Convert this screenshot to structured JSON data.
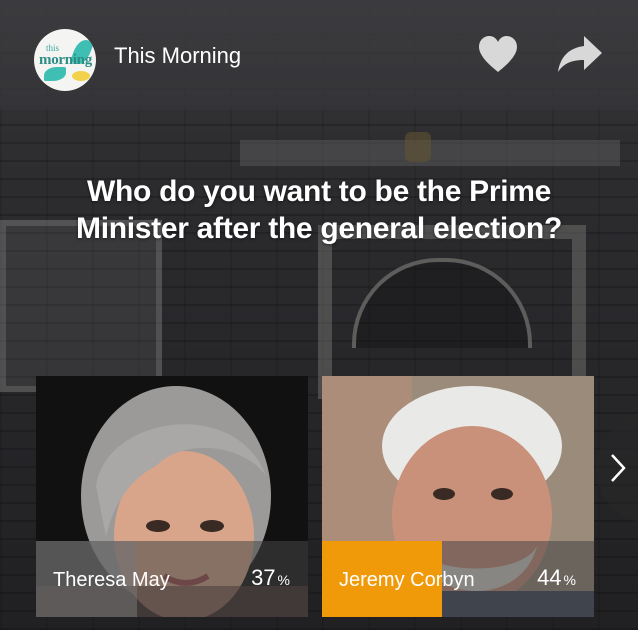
{
  "header": {
    "logo_text_small": "this",
    "logo_text_large": "morning",
    "brand_name": "This Morning",
    "like_icon": "heart-icon",
    "share_icon": "share-arrow-icon"
  },
  "poll": {
    "question": "Who do you want to be the Prime Minister after the general election?",
    "options": [
      {
        "name": "Theresa May",
        "percent": 37,
        "percent_text": "37",
        "percent_sign": "%",
        "accent": "#777777"
      },
      {
        "name": "Jeremy Corbyn",
        "percent": 44,
        "percent_text": "44",
        "percent_sign": "%",
        "accent": "#f09a0a"
      }
    ],
    "next_icon": "chevron-right-icon"
  },
  "colors": {
    "text": "#ffffff",
    "highlight": "#f09a0a"
  }
}
